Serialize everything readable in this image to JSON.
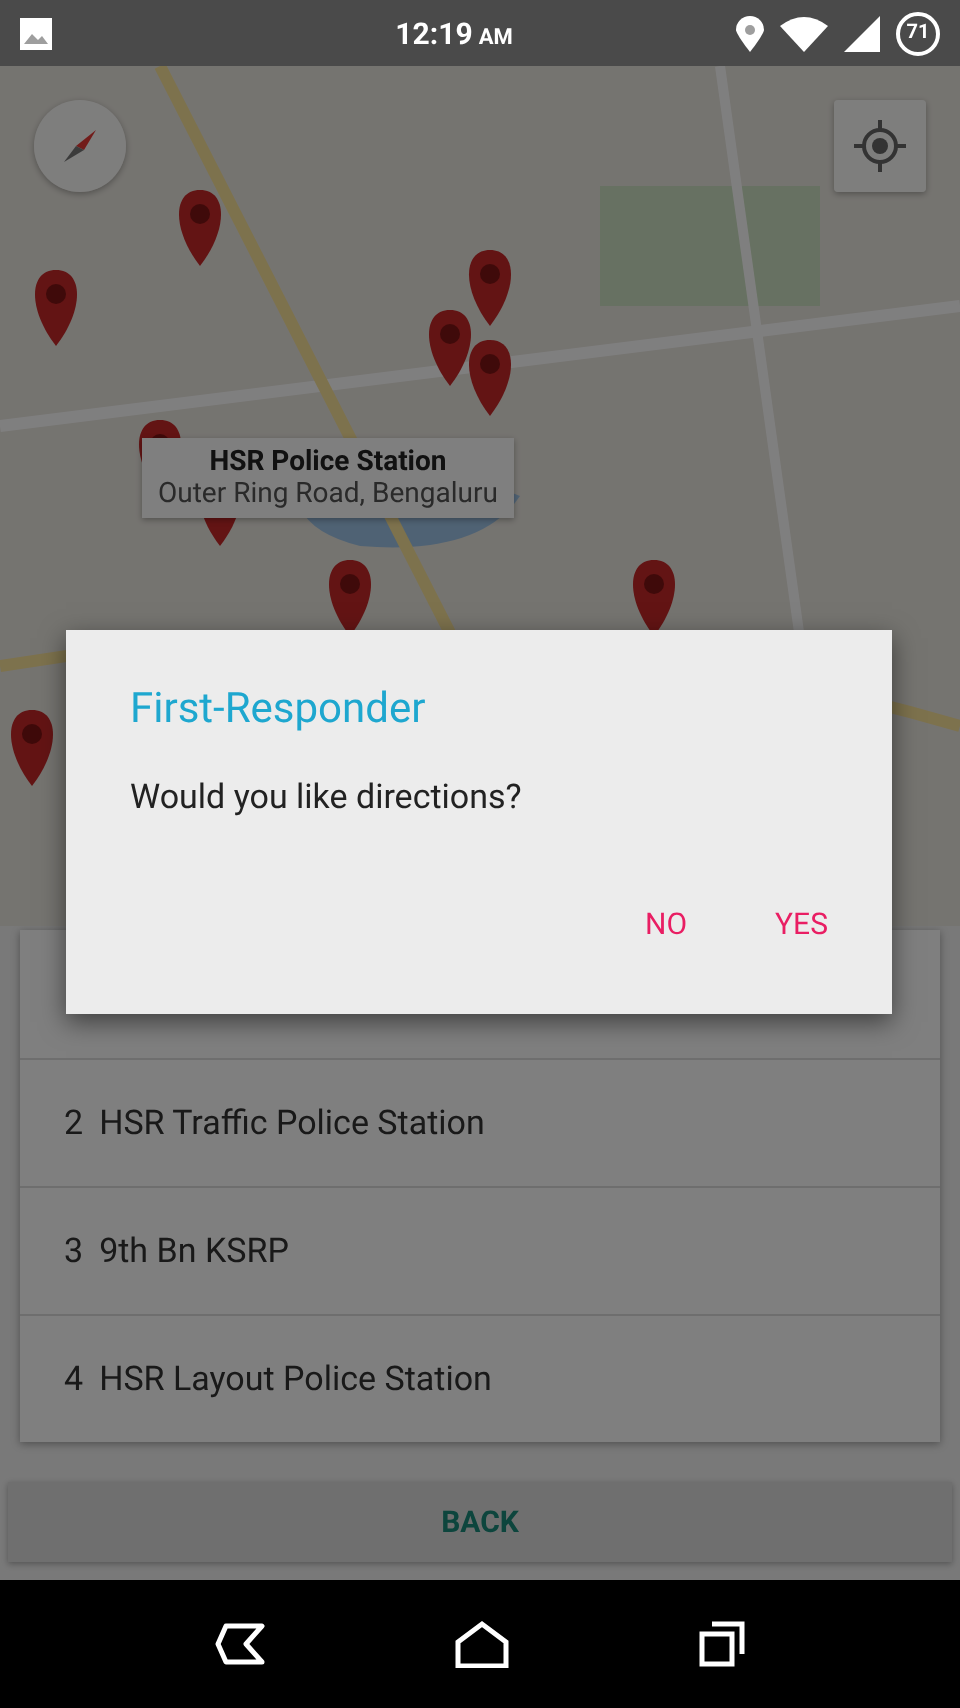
{
  "status_bar": {
    "time": "12:19",
    "meridiem": "AM",
    "battery": "71"
  },
  "map": {
    "info_window": {
      "title": "HSR Police Station",
      "subtitle": "Outer Ring Road, Bengaluru"
    }
  },
  "stations": [
    {
      "number": "2",
      "name": "HSR Traffic Police Station"
    },
    {
      "number": "3",
      "name": "9th Bn KSRP"
    },
    {
      "number": "4",
      "name": "HSR Layout Police Station"
    }
  ],
  "back_button": "BACK",
  "dialog": {
    "title": "First-Responder",
    "message": "Would you like directions?",
    "buttons": [
      "NO",
      "YES"
    ]
  }
}
